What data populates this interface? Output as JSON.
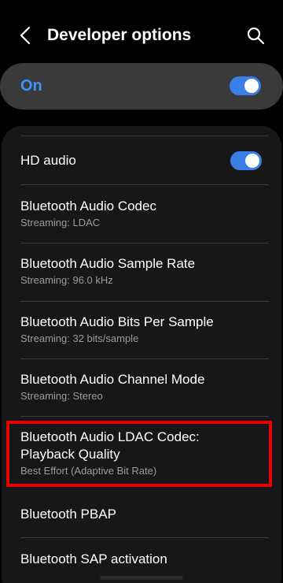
{
  "header": {
    "title": "Developer options",
    "back_icon": "arrow-back-icon",
    "search_icon": "search-icon"
  },
  "master_toggle": {
    "label": "On",
    "state": true
  },
  "settings": [
    {
      "title": "HD audio",
      "toggle": true
    },
    {
      "title": "Bluetooth Audio Codec",
      "subtitle": "Streaming: LDAC"
    },
    {
      "title": "Bluetooth Audio Sample Rate",
      "subtitle": "Streaming: 96.0 kHz"
    },
    {
      "title": "Bluetooth Audio Bits Per Sample",
      "subtitle": "Streaming: 32 bits/sample"
    },
    {
      "title": "Bluetooth Audio Channel Mode",
      "subtitle": "Streaming: Stereo"
    },
    {
      "title_line1": "Bluetooth Audio LDAC Codec:",
      "title_line2": "Playback Quality",
      "subtitle": "Best Effort (Adaptive Bit Rate)",
      "highlighted": true
    },
    {
      "title": "Bluetooth PBAP"
    },
    {
      "title": "Bluetooth SAP activation"
    }
  ],
  "colors": {
    "accent": "#3e91ff",
    "toggle_on": "#3a7ee8",
    "highlight": "#e60000",
    "background": "#000000",
    "card": "#171717",
    "master_row": "#3a3a3a",
    "subtitle_text": "#9b9b9b"
  }
}
